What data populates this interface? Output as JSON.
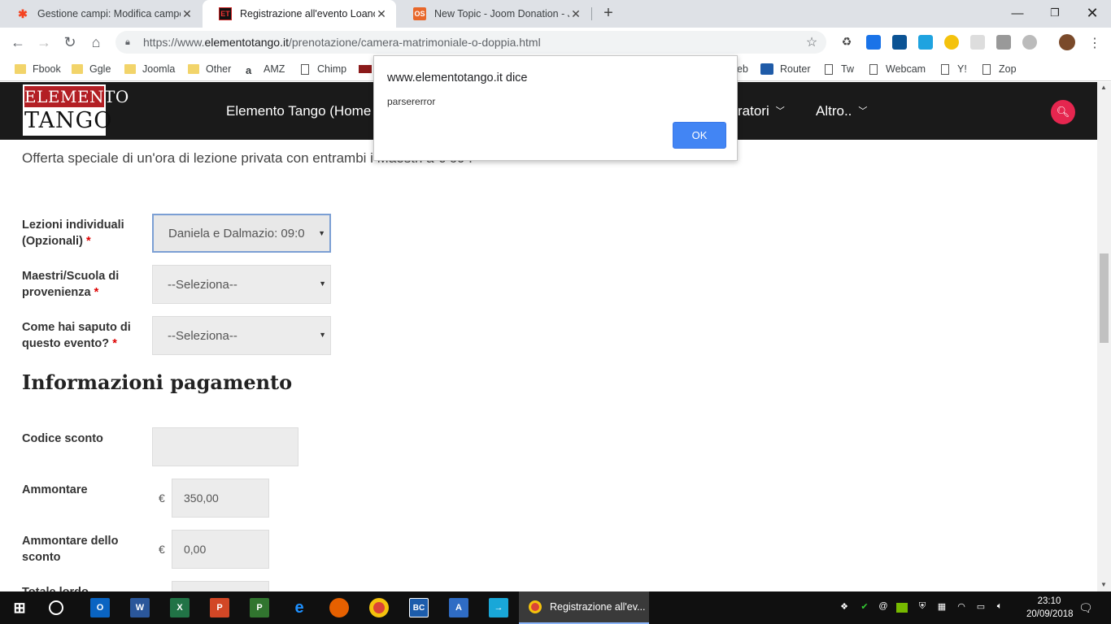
{
  "browser": {
    "tabs": [
      {
        "title": "Gestione campi: Modifica campo"
      },
      {
        "title": "Registrazione all'evento Loano Ta"
      },
      {
        "title": "New Topic - Joom Donation - Joo"
      }
    ],
    "url_prefix": "https://www.",
    "url_host": "elementotango.it",
    "url_path": "/prenotazione/camera-matrimoniale-o-doppia.html",
    "bookmarks": [
      "Fbook",
      "Ggle",
      "Joomla",
      "Other",
      "AMZ",
      "Chimp",
      "eb",
      "Router",
      "Tw",
      "Webcam",
      "Y!",
      "Zop"
    ]
  },
  "site": {
    "logo_top": "ELEMENTO",
    "logo_bottom": "TANGO",
    "menu": [
      "Elemento Tango (Home",
      "ratori",
      "Altro.."
    ]
  },
  "form": {
    "offer_text": "Offerta speciale di un'ora di lezione privata con entrambi i Maestri a € 60 .",
    "required_mark": "*",
    "lezioni_label": "Lezioni individuali (Opzionali)",
    "lezioni_value": "Daniela e Dalmazio: 09:0",
    "maestri_label": "Maestri/Scuola di provenienza",
    "maestri_value": "--Seleziona--",
    "saputo_label": "Come hai saputo di questo evento?",
    "saputo_value": "--Seleziona--",
    "payment_heading": "Informazioni pagamento",
    "codice_label": "Codice sconto",
    "codice_value": "",
    "ammontare_label": "Ammontare",
    "currency": "€",
    "ammontare_value": "350,00",
    "sconto_label": "Ammontare dello sconto",
    "sconto_value": "0,00",
    "totale_label": "Totale lordo"
  },
  "dialog": {
    "title": "www.elementotango.it dice",
    "message": "parsererror",
    "ok_label": "OK"
  },
  "taskbar": {
    "active_window": "Registrazione all'ev...",
    "time": "23:10",
    "date": "20/09/2018"
  }
}
